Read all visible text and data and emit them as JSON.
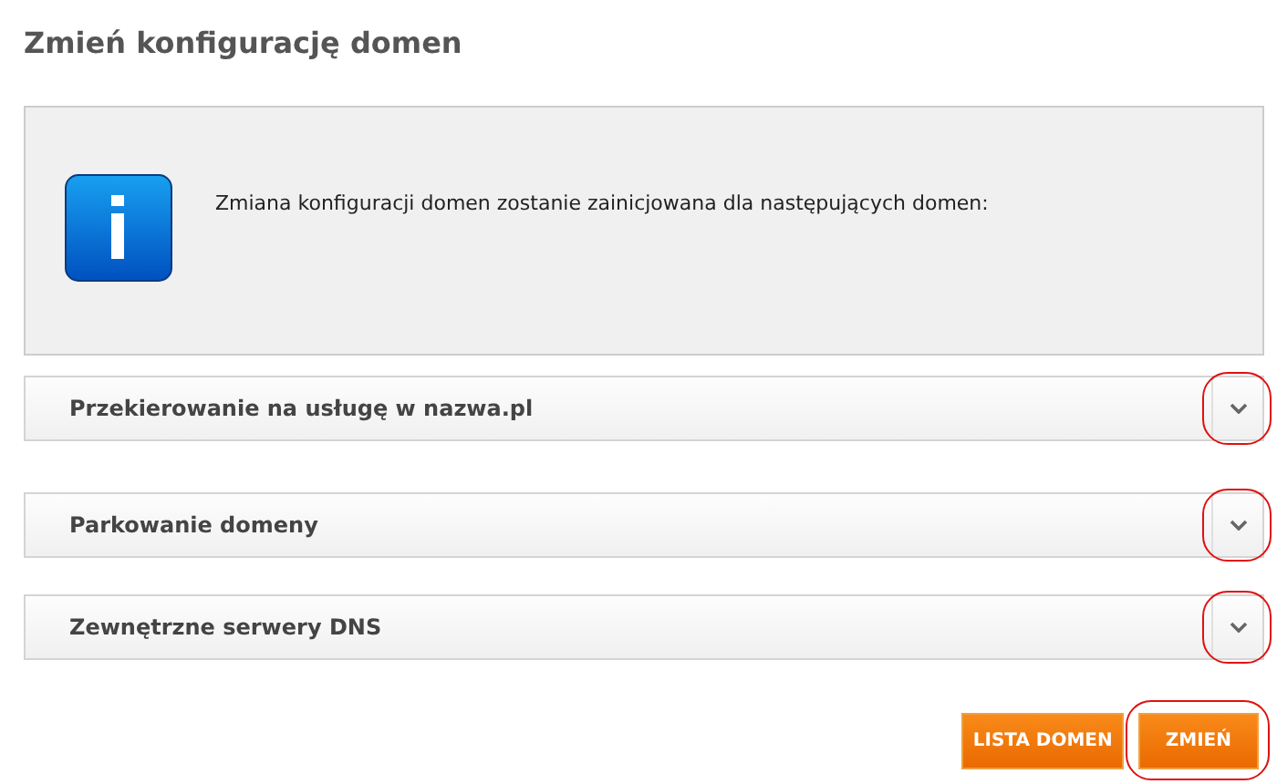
{
  "title": "Zmień konfigurację domen",
  "info": {
    "message": "Zmiana konfiguracji domen zostanie zainicjowana dla następujących domen:"
  },
  "sections": [
    {
      "label": "Przekierowanie na usługę w nazwa.pl",
      "expanded": false,
      "highlighted": true
    },
    {
      "label": "Parkowanie domeny",
      "expanded": false,
      "highlighted": true
    },
    {
      "label": "Zewnętrzne serwery DNS",
      "expanded": false,
      "highlighted": true
    }
  ],
  "buttons": [
    {
      "label": "LISTA DOMEN",
      "highlighted": false
    },
    {
      "label": "ZMIEŃ",
      "highlighted": true
    }
  ]
}
